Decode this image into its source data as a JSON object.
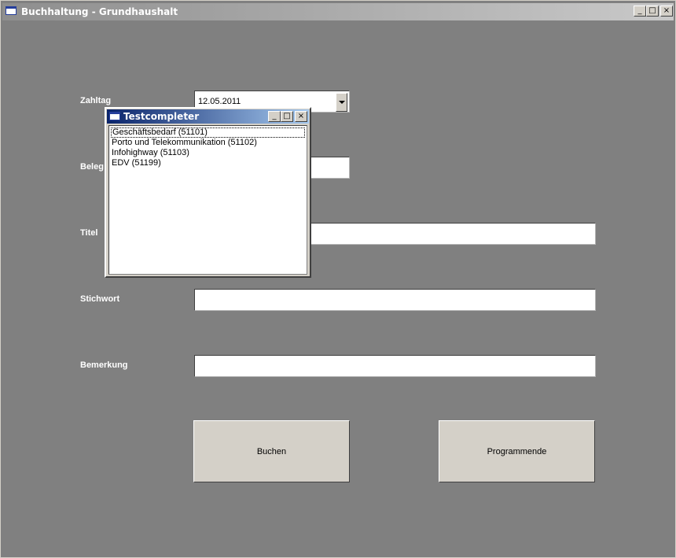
{
  "window": {
    "title": "Buchhaltung - Grundhaushalt",
    "controls": {
      "minimize": "_",
      "maximize": "□",
      "close": "×"
    }
  },
  "form": {
    "zahltag_label": "Zahltag",
    "zahltag_value": "12.05.2011",
    "beleg_label": "Beleg",
    "titel_label": "Titel",
    "stichwort_label": "Stichwort",
    "bemerkung_label": "Bemerkung"
  },
  "buttons": {
    "buchen": "Buchen",
    "programmende": "Programmende"
  },
  "popup": {
    "title": "Testcompleter",
    "controls": {
      "minimize": "_",
      "maximize": "□",
      "close": "×"
    },
    "items": [
      "Geschäftsbedarf (51101)",
      "Porto und Telekommunikation (51102)",
      "Infohighway (51103)",
      "EDV (51199)"
    ]
  }
}
